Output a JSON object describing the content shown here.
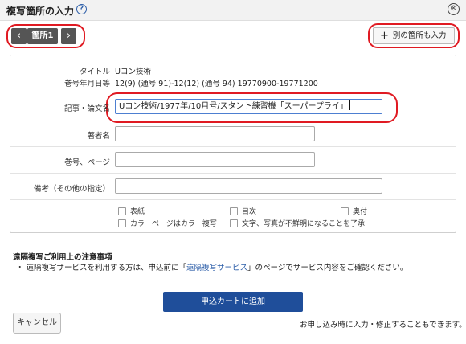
{
  "header": {
    "title": "複写箇所の入力",
    "help_icon": "?",
    "close_icon": "⊗"
  },
  "nav": {
    "prev_icon": "‹",
    "location_label": "箇所1",
    "next_icon": "›"
  },
  "add_location": {
    "label": "別の箇所も入力",
    "plus_icon": "+"
  },
  "details": {
    "title_label": "タイトル",
    "title_value": "Uコン技術",
    "volume_label": "巻号年月日等",
    "volume_value": "12(9) (通号 91)-12(12) (通号 94) 19770900-19771200"
  },
  "form": {
    "article_label": "記事・論文名",
    "article_value": "Uコン技術/1977年/10月号/スタント練習機「スーパープライ」",
    "author_label": "著者名",
    "author_value": "",
    "pages_label": "巻号、ページ",
    "pages_value": "",
    "remarks_label": "備考（その他の指定）",
    "remarks_value": ""
  },
  "checkboxes": [
    {
      "label": "表紙",
      "checked": false
    },
    {
      "label": "目次",
      "checked": false
    },
    {
      "label": "奥付",
      "checked": false
    },
    {
      "label": "カラーページはカラー複写",
      "checked": false
    },
    {
      "label": "文字、写真が不鮮明になることを了承",
      "checked": false
    }
  ],
  "notes": {
    "title": "遠隔複写ご利用上の注意事項",
    "line_prefix": "・ 遠隔複写サービスを利用する方は、申込前に「",
    "line_link": "遠隔複写サービス",
    "line_suffix": "」のページでサービス内容をご確認ください。"
  },
  "actions": {
    "add_to_cart": "申込カートに追加",
    "cancel": "キャンセル",
    "edit_note": "お申し込み時に入力・修正することもできます。"
  },
  "colors": {
    "accent": "#1f4e9a",
    "highlight": "#e01a22",
    "nav_button": "#555555"
  }
}
